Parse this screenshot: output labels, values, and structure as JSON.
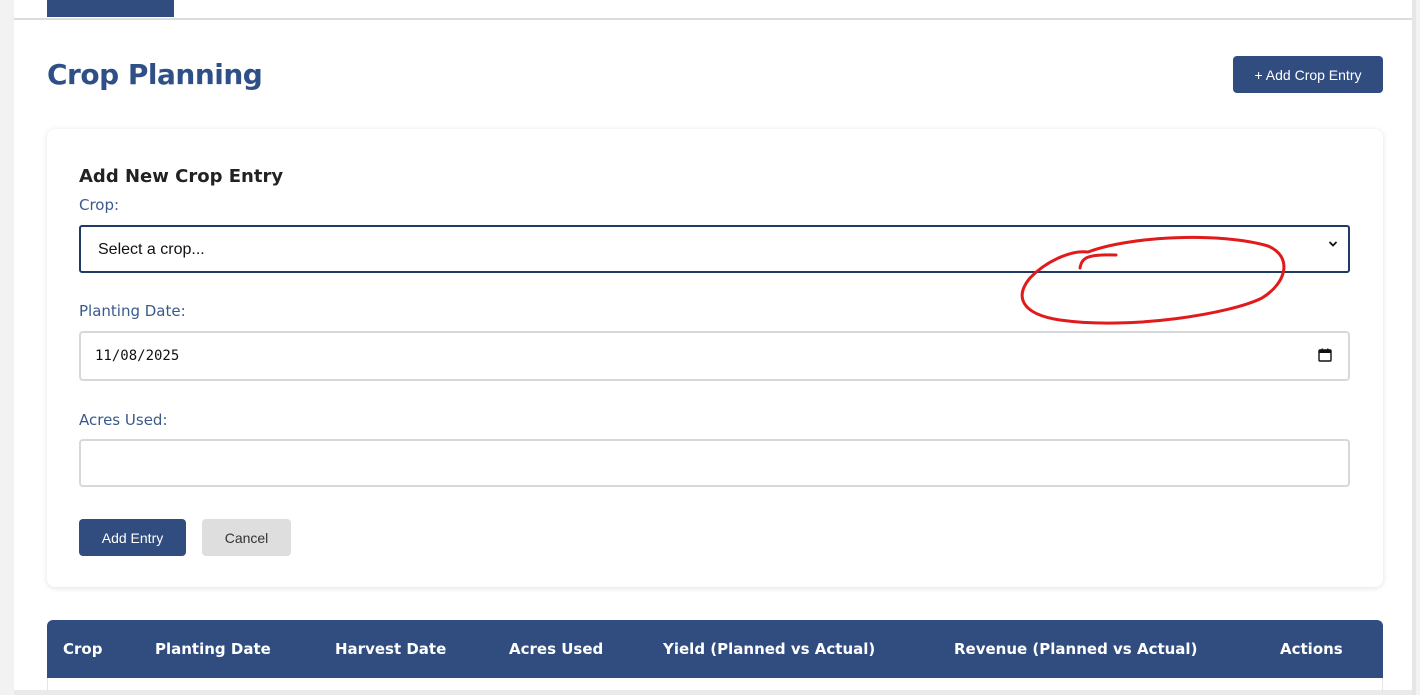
{
  "page": {
    "title": "Crop Planning",
    "add_button_label": "+ Add Crop Entry"
  },
  "form": {
    "title": "Add New Crop Entry",
    "crop_label": "Crop:",
    "crop_selected": "Select a crop...",
    "planting_date_label": "Planting Date:",
    "planting_date_value": "11/08/2025",
    "acres_label": "Acres Used:",
    "acres_value": "",
    "submit_label": "Add Entry",
    "cancel_label": "Cancel"
  },
  "table": {
    "columns": [
      "Crop",
      "Planting Date",
      "Harvest Date",
      "Acres Used",
      "Yield (Planned vs Actual)",
      "Revenue (Planned vs Actual)",
      "Actions"
    ]
  },
  "colors": {
    "primary": "#314d80",
    "title": "#2f4f87",
    "annotation": "#e01b1b"
  },
  "icons": {
    "select_arrow": "chevron-down-icon",
    "date_picker": "calendar-icon"
  }
}
